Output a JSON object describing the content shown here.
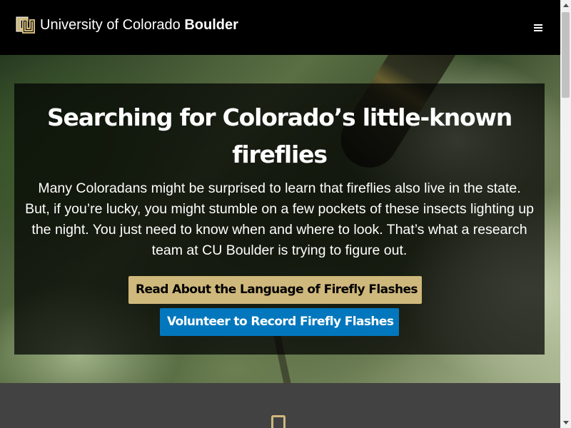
{
  "header": {
    "logo_name": "University of Colorado ",
    "logo_name_bold": "Boulder",
    "logo_icon": "cu-logo-icon",
    "menu_icon": "hamburger-menu-icon"
  },
  "hero": {
    "title": "Searching for Colorado’s little-known fireflies",
    "body": "Many Coloradans might be surprised to learn that fireflies also live in the state. But, if you’re lucky, you might stumble on a few pockets of these insects lighting up the night. You just need to know when and where to look. That’s what a research team at CU Boulder is trying to figure out.",
    "primary_button": "Read About the Language of Firefly Flashes",
    "secondary_button": "Volunteer to Record Firefly Flashes"
  },
  "lower_section": {
    "icon": "mobile-phone-icon"
  },
  "colors": {
    "header_bg": "#000000",
    "gold": "#cfb87c",
    "blue": "#0277bd",
    "section_bg": "#424242"
  }
}
